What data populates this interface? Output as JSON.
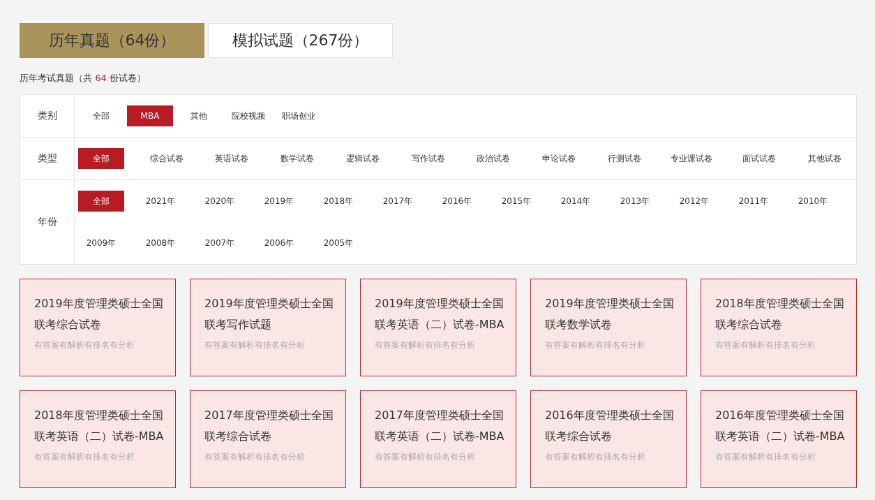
{
  "tabs": [
    {
      "label": "历年真题（64份）",
      "selected": true
    },
    {
      "label": "模拟试题（267份）",
      "selected": false
    }
  ],
  "summary": {
    "prefix": "历年考试真题（共 ",
    "count": "64",
    "suffix": " 份试卷）"
  },
  "filters": [
    {
      "label": "类别",
      "options": [
        {
          "label": "全部",
          "selected": false
        },
        {
          "label": "MBA",
          "selected": true
        },
        {
          "label": "其他",
          "selected": false
        },
        {
          "label": "院校视频",
          "selected": false
        },
        {
          "label": "职场创业",
          "selected": false
        }
      ]
    },
    {
      "label": "类型",
      "options": [
        {
          "label": "全部",
          "selected": true
        },
        {
          "label": "综合试卷",
          "selected": false
        },
        {
          "label": "英语试卷",
          "selected": false
        },
        {
          "label": "数学试卷",
          "selected": false
        },
        {
          "label": "逻辑试卷",
          "selected": false
        },
        {
          "label": "写作试卷",
          "selected": false
        },
        {
          "label": "政治试卷",
          "selected": false
        },
        {
          "label": "申论试卷",
          "selected": false
        },
        {
          "label": "行测试卷",
          "selected": false
        },
        {
          "label": "专业课试卷",
          "selected": false
        },
        {
          "label": "面试试卷",
          "selected": false
        },
        {
          "label": "其他试卷",
          "selected": false
        }
      ]
    },
    {
      "label": "年份",
      "options": [
        {
          "label": "全部",
          "selected": true
        },
        {
          "label": "2021年",
          "selected": false
        },
        {
          "label": "2020年",
          "selected": false
        },
        {
          "label": "2019年",
          "selected": false
        },
        {
          "label": "2018年",
          "selected": false
        },
        {
          "label": "2017年",
          "selected": false
        },
        {
          "label": "2016年",
          "selected": false
        },
        {
          "label": "2015年",
          "selected": false
        },
        {
          "label": "2014年",
          "selected": false
        },
        {
          "label": "2013年",
          "selected": false
        },
        {
          "label": "2012年",
          "selected": false
        },
        {
          "label": "2011年",
          "selected": false
        },
        {
          "label": "2010年",
          "selected": false
        },
        {
          "label": "2009年",
          "selected": false
        },
        {
          "label": "2008年",
          "selected": false
        },
        {
          "label": "2007年",
          "selected": false
        },
        {
          "label": "2006年",
          "selected": false
        },
        {
          "label": "2005年",
          "selected": false
        }
      ]
    }
  ],
  "papers": [
    {
      "title": "2019年度管理类硕士全国联考综合试卷",
      "note": "有答案有解析有排名有分析"
    },
    {
      "title": "2019年度管理类硕士全国联考写作试题",
      "note": "有答案有解析有排名有分析"
    },
    {
      "title": "2019年度管理类硕士全国联考英语（二）试卷-MBA",
      "note": "有答案有解析有排名有分析"
    },
    {
      "title": "2019年度管理类硕士全国联考数学试卷",
      "note": "有答案有解析有排名有分析"
    },
    {
      "title": "2018年度管理类硕士全国联考综合试卷",
      "note": "有答案有解析有排名有分析"
    },
    {
      "title": "2018年度管理类硕士全国联考英语（二）试卷-MBA",
      "note": "有答案有解析有排名有分析"
    },
    {
      "title": "2017年度管理类硕士全国联考综合试卷",
      "note": "有答案有解析有排名有分析"
    },
    {
      "title": "2017年度管理类硕士全国联考英语（二）试卷-MBA",
      "note": "有答案有解析有排名有分析"
    },
    {
      "title": "2016年度管理类硕士全国联考综合试卷",
      "note": "有答案有解析有排名有分析"
    },
    {
      "title": "2016年度管理类硕士全国联考英语（二）试卷-MBA",
      "note": "有答案有解析有排名有分析"
    }
  ]
}
